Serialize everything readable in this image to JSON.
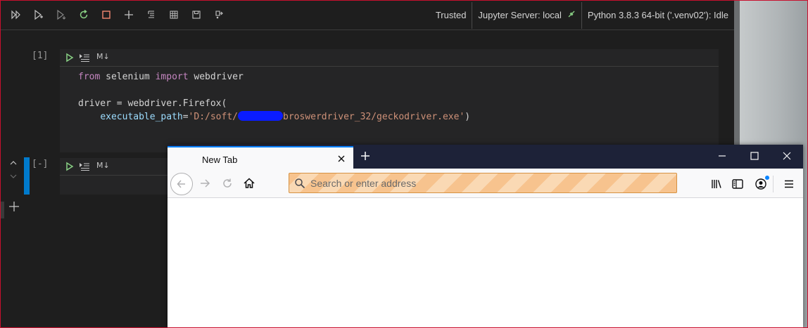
{
  "toolbar": {
    "trusted_label": "Trusted",
    "server_label": "Jupyter Server: local",
    "kernel_label": "Python 3.8.3 64-bit ('.venv02'): Idle"
  },
  "cells": [
    {
      "execution_count": "[1]",
      "markdown_label": "M↓",
      "code": {
        "line1_from": "from",
        "line1_module": " selenium ",
        "line1_import": "import",
        "line1_name": " webdriver",
        "line3": "driver = webdriver.Firefox(",
        "line4_indent": "    ",
        "line4_param": "executable_path",
        "line4_eq": "=",
        "line4_str_a": "'D:/soft/",
        "line4_str_b": "broswerdriver_32/geckodriver.exe'",
        "line4_close": ")"
      }
    },
    {
      "execution_count": "[-]",
      "markdown_label": "M↓"
    }
  ],
  "firefox": {
    "tab_title": "New Tab",
    "address_placeholder": "Search or enter address"
  },
  "colors": {
    "editor_bg": "#1e1e1e",
    "cell_bg": "#252526",
    "active_cell_bar": "#007acc",
    "firefox_titlebar": "#1d2238",
    "firefox_tab_accent": "#0a84ff",
    "urlbar_stripe_a": "#f7c38e",
    "urlbar_stripe_b": "#fad9b4",
    "keyword": "#c586c0",
    "string": "#ce9178",
    "parameter": "#9cdcfe",
    "run_green": "#89d185"
  }
}
